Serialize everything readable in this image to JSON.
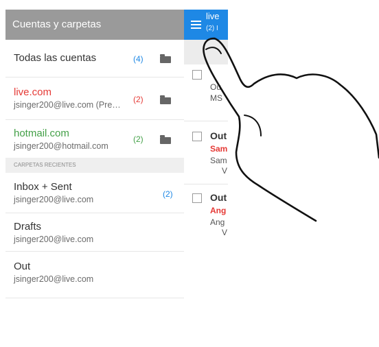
{
  "drawer": {
    "header": "Cuentas y carpetas",
    "accounts": [
      {
        "title": "Todas las cuentas",
        "count": "(4)",
        "title_color": "#333333",
        "count_color": "#1e88e5"
      },
      {
        "title": "live.com",
        "subtitle": "jsinger200@live.com (Pre…",
        "count": "(2)",
        "title_color": "#e53935",
        "count_color": "#e53935"
      },
      {
        "title": "hotmail.com",
        "subtitle": "jsinger200@hotmail.com",
        "count": "(2)",
        "title_color": "#43a047",
        "count_color": "#43a047"
      }
    ],
    "section_label": "CARPETAS RECIENTES",
    "recent_folders": [
      {
        "title": "Inbox + Sent",
        "subtitle": "jsinger200@live.com",
        "count": "(2)",
        "count_color": "#1e88e5"
      },
      {
        "title": "Drafts",
        "subtitle": "jsinger200@live.com"
      },
      {
        "title": "Out",
        "subtitle": "jsinger200@live.com"
      }
    ]
  },
  "right_panel": {
    "title": "live",
    "subtitle": "(2) I",
    "messages": [
      {
        "line1": "Ou",
        "line2": "MS"
      },
      {
        "subject": "Out",
        "sender": "Sam",
        "preview": "Sam",
        "preview2": "V"
      },
      {
        "subject": "Out",
        "sender": "Ang",
        "preview": "Ang",
        "preview2": "V"
      }
    ]
  },
  "colors": {
    "accent": "#1e88e5",
    "header_gray": "#9a9a9a"
  },
  "icons": [
    "menu-icon",
    "folder-icon",
    "checkbox-icon",
    "pointing-hand-icon"
  ]
}
